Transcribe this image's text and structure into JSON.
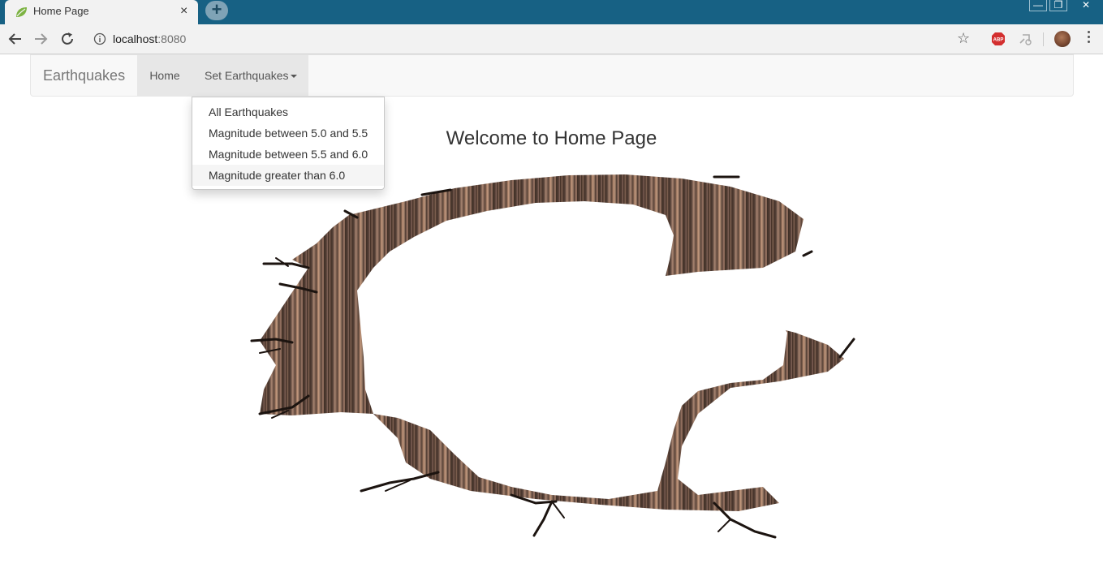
{
  "browser": {
    "tab_title": "Home Page",
    "tab_close": "×",
    "new_tab": "+",
    "url_host": "localhost",
    "url_port": ":8080",
    "icons": [
      "leaf-favicon-icon",
      "back-icon",
      "forward-icon",
      "reload-icon",
      "info-icon",
      "bookmark-star-icon",
      "adblock-icon",
      "extension-icon",
      "profile-avatar",
      "menu-kebab-icon"
    ],
    "titlebar_color": "#176184"
  },
  "navbar": {
    "brand": "Earthquakes",
    "home": "Home",
    "set_earthquakes": "Set Earthquakes"
  },
  "dropdown": {
    "items": [
      "All Earthquakes",
      "Magnitude between 5.0 and 5.5",
      "Magnitude between 5.5 and 6.0",
      "Magnitude greater than 6.0"
    ],
    "highlighted_index": 3
  },
  "main": {
    "heading": "Welcome to Home Page"
  }
}
